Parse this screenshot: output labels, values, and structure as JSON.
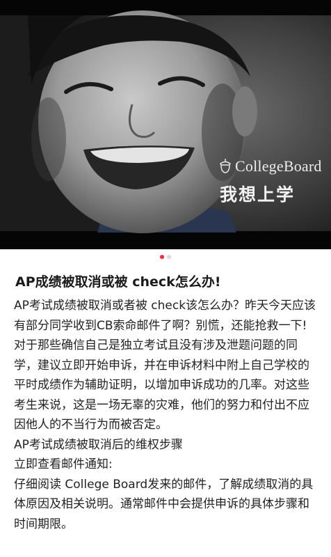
{
  "hero": {
    "brand_name": "CollegeBoard",
    "slogan": "我想上学",
    "slide_count": 2,
    "active_slide": 1
  },
  "post": {
    "title": "AP成绩被取消或被 check怎么办!",
    "paragraphs": [
      "AP考试成绩被取消或者被 check该怎么办？昨天今天应该有部分同学收到CB索命邮件了啊？别慌，还能抢救一下!",
      "对于那些确信自己是独立考试且没有涉及泄题问题的同学，建议立即开始申诉，并在申诉材料中附上自己学校的平时成绩作为辅助证明，以增加申诉成功的几率。对这些考生来说，这是一场无辜的灾难，他们的努力和付出不应因他人的不当行为而被否定。",
      "AP考试成绩被取消后的维权步骤",
      "立即查看邮件通知:",
      "仔细阅读 College Board发来的邮件，了解成绩取消的具体原因及相关说明。通常邮件中会提供申诉的具体步骤和时间期限。"
    ]
  },
  "colors": {
    "accent": "#ff2442",
    "text": "#1a1a1a",
    "hero_bg": "#0d0d0d"
  }
}
